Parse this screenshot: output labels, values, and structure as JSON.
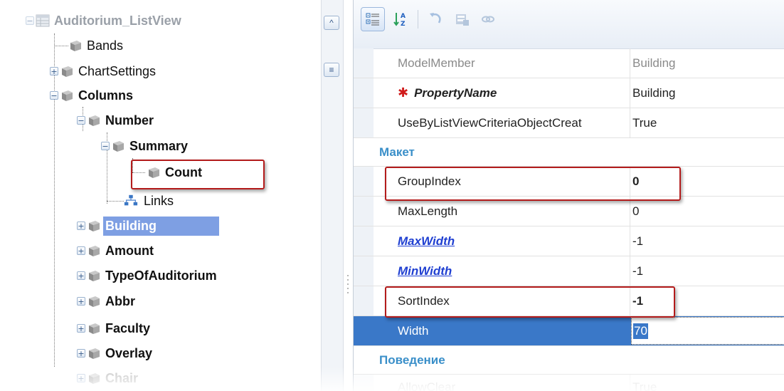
{
  "tree": {
    "root_label": "Auditorium_ListView",
    "nodes": {
      "bands": "Bands",
      "chart_settings": "ChartSettings",
      "columns": "Columns",
      "number": "Number",
      "summary": "Summary",
      "count": "Count",
      "links": "Links",
      "building": "Building",
      "amount": "Amount",
      "type_of_auditorium": "TypeOfAuditorium",
      "abbr": "Abbr",
      "faculty": "Faculty",
      "overlay": "Overlay",
      "chair": "Chair"
    },
    "selected": "Building"
  },
  "property_grid": {
    "rows": {
      "model_member": {
        "name": "ModelMember",
        "value": "Building"
      },
      "property_name": {
        "name": "PropertyName",
        "value": "Building"
      },
      "use_by_listview": {
        "name": "UseByListViewCriteriaObjectCreat",
        "value": "True"
      },
      "group_index": {
        "name": "GroupIndex",
        "value": "0"
      },
      "max_length": {
        "name": "MaxLength",
        "value": "0"
      },
      "max_width": {
        "name": "MaxWidth",
        "value": "-1"
      },
      "min_width": {
        "name": "MinWidth",
        "value": "-1"
      },
      "sort_index": {
        "name": "SortIndex",
        "value": "-1"
      },
      "width": {
        "name": "Width",
        "value": "70"
      },
      "allow_clear": {
        "name": "AllowClear",
        "value": "True"
      }
    },
    "categories": {
      "layout": "Макет",
      "behavior": "Поведение"
    },
    "selected_row": "Width"
  },
  "colors": {
    "selection": "#3a78c8",
    "tree_selection": "#7e9fe3",
    "highlight_box": "#b31b1b",
    "category_text": "#3a8fc9"
  }
}
